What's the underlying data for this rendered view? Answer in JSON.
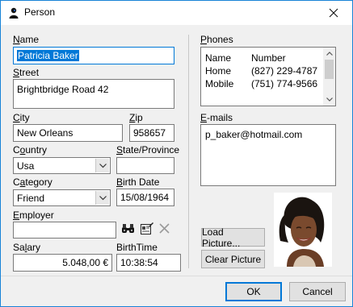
{
  "window": {
    "title": "Person",
    "app_icon": "person-silhouette-icon",
    "close_icon": "close-icon"
  },
  "name": {
    "label": "Name",
    "value": "Patricia Baker"
  },
  "street": {
    "label": "Street",
    "value": "Brightbridge Road 42"
  },
  "city": {
    "label": "City",
    "value": "New Orleans"
  },
  "zip": {
    "label": "Zip",
    "value": "958657"
  },
  "country": {
    "label": "Country",
    "value": "Usa"
  },
  "state": {
    "label": "State/Province",
    "value": ""
  },
  "category": {
    "label": "Category",
    "value": "Friend"
  },
  "birth_date": {
    "label": "Birth Date",
    "value": "15/08/1964"
  },
  "employer": {
    "label": "Employer",
    "value": "",
    "icons": [
      "binoculars-icon",
      "edit-record-icon",
      "clear-x-icon"
    ]
  },
  "salary": {
    "label": "Salary",
    "value": "5.048,00 €"
  },
  "birth_time": {
    "label": "BirthTime",
    "value": "10:38:54"
  },
  "phones": {
    "label": "Phones",
    "header": {
      "name": "Name",
      "number": "Number"
    },
    "rows": [
      {
        "name": "Home",
        "number": "(827) 229-4787"
      },
      {
        "name": "Mobile",
        "number": "(751) 774-9566"
      }
    ]
  },
  "emails": {
    "label": "E-mails",
    "items": [
      "p_baker@hotmail.com"
    ]
  },
  "buttons": {
    "load_picture": "Load Picture...",
    "clear_picture": "Clear Picture",
    "ok": "OK",
    "cancel": "Cancel"
  },
  "colors": {
    "selection": "#0078d7",
    "border": "#1883d7",
    "dialog_bg": "#f0f0f0"
  }
}
